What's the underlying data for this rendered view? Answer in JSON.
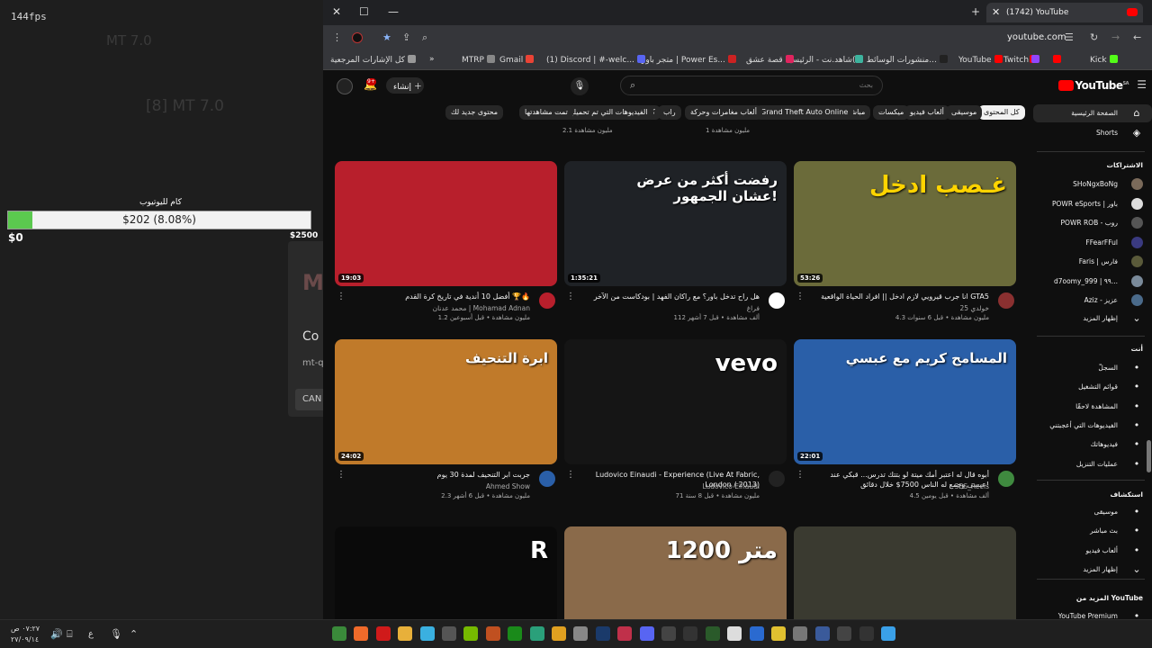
{
  "overlay": {
    "fps": "144fps",
    "ghost_a": "MT 7.0",
    "ghost_b": "[8] MT 7.0",
    "goal_title": "كام لليوتيوب",
    "goal_text": "$202 (8.08%)",
    "goal_progress_pct": 8.08,
    "goal_min": "$0",
    "goal_max": "$2500",
    "dialog": {
      "logo": "M",
      "title": "Co",
      "url": "mt-q",
      "button": "CAN"
    }
  },
  "browser": {
    "tab_title": "(1742) YouTube",
    "url": "youtube.com",
    "bookmarks": [
      {
        "label": "Kick",
        "color": "#53fc18"
      },
      {
        "label": "",
        "color": "#ff0000"
      },
      {
        "label": "",
        "color": "#ff0000"
      },
      {
        "label": "Twitch",
        "color": "#9146ff"
      },
      {
        "label": "YouTube",
        "color": "#ff0000"
      },
      {
        "label": "(1) منشورات الوسائط...",
        "color": "#222222"
      },
      {
        "label": "شاهد.نت - الرئيسية",
        "color": "#3db39e"
      },
      {
        "label": "قصة عشق",
        "color": "#e0245e"
      },
      {
        "label": "متجر باور | Power Es...",
        "color": "#cc2222"
      },
      {
        "label": "(1) Discord | #-welc...",
        "color": "#5865f2"
      },
      {
        "label": "Gmail",
        "color": "#ea4335"
      },
      {
        "label": "MTRP",
        "color": "#888888"
      },
      {
        "label": "»",
        "color": ""
      },
      {
        "label": "كل الإشارات المرجعية",
        "color": "#999999"
      }
    ]
  },
  "youtube": {
    "logo": "YouTube",
    "country": "SA",
    "search_placeholder": "بحث",
    "create_label": "إنشاء",
    "notif_count": "9+",
    "chips": [
      {
        "label": "كل المحتوى",
        "active": true
      },
      {
        "label": "موسيقى",
        "active": false
      },
      {
        "label": "ألعاب فيديو",
        "active": false
      },
      {
        "label": "ميكسات",
        "active": false
      },
      {
        "label": "مباشر",
        "active": false
      },
      {
        "label": "Grand Theft Auto Online",
        "active": false
      },
      {
        "label": "ألعاب مغامرات وحركة",
        "active": false
      },
      {
        "label": "راب",
        "active": false
      },
      {
        "label": "كرة القدم",
        "active": false
      },
      {
        "label": "الفيديوهات التي تم تحميلها مؤخرًا",
        "active": false
      },
      {
        "label": "تمت مشاهدتها",
        "active": false
      },
      {
        "label": "محتوى جديد لك",
        "active": false
      }
    ],
    "prev_meta": [
      "1 مليون مشاهدة",
      "2.1 مليون مشاهدة"
    ],
    "videos": [
      {
        "title": "انا جرب قيرويي لازم ادخل || افراد الحياة الواقعية GTA5",
        "channel": "خولدي 25",
        "meta": "4.3 مليون مشاهدة • قبل 6 سنوات",
        "duration": "53:26",
        "thumb_text": "غـصب ادخل",
        "bg": "#6b6b3a",
        "av": "#8a3030"
      },
      {
        "title": "هل راح تدخل باور؟ مع راكان الفهد | بودكاست من الآخر",
        "channel": "فراغ",
        "meta": "112 ألف مشاهدة • قبل 7 أشهر",
        "duration": "1:35:21",
        "thumb_text": "رفضت أكثر من عرض عشان الجمهور!",
        "bg": "#1f2226",
        "av": "#ffffff"
      },
      {
        "title": "أفضل 10 أندية في تاريخ كرة القدم 🏆🔥",
        "channel": "محمد عدنان | Mohamad Adnan",
        "meta": "1.2 مليون مشاهدة • قبل أسبوعين",
        "duration": "19:03",
        "thumb_text": "",
        "bg": "#b81f2c",
        "av": "#b81f2c"
      },
      {
        "title": "أبوه قال له اعتبر أمك ميتة لو بتتك تدرس... قبكي عند عيسى وجمع له الناس 7500$ خلال دقائق!",
        "channel": "3BS_Reels",
        "meta": "4.5 ألف مشاهدة • قبل يومين",
        "duration": "22:01",
        "thumb_text": "المسامح كريم مع عبسي",
        "bg": "#2a5fa8",
        "av": "#3f8a3f"
      },
      {
        "title": "Ludovico Einaudi - Experience (Live At Fabric, London / 2013)",
        "channel": "Ludovico Einaudi",
        "meta": "71 مليون مشاهدة • قبل 8 سنة",
        "duration": "",
        "thumb_text": "vevo",
        "bg": "#151515",
        "av": "#222222"
      },
      {
        "title": "جربت ابر التنحيف لمدة 30 يوم",
        "channel": "Ahmed Show",
        "meta": "2.3 مليون مشاهدة • قبل 6 أشهر",
        "duration": "24:02",
        "thumb_text": "ابرة التنحيف",
        "bg": "#c07a2a",
        "av": "#2a5fa8"
      },
      {
        "title": "",
        "channel": "",
        "meta": "",
        "duration": "",
        "thumb_text": "",
        "bg": "#3a3a30",
        "av": ""
      },
      {
        "title": "",
        "channel": "",
        "meta": "",
        "duration": "",
        "thumb_text": "1200 متر",
        "bg": "#8a6a4a",
        "av": ""
      },
      {
        "title": "",
        "channel": "",
        "meta": "",
        "duration": "",
        "thumb_text": "R",
        "bg": "#0a0a0a",
        "av": ""
      }
    ],
    "guide": {
      "home": "الصفحة الرئيسية",
      "shorts": "Shorts",
      "subs_header": "الاشتراكات",
      "subs": [
        {
          "name": "SHoNgxBoNg",
          "color": "#7a6a5a"
        },
        {
          "name": "POWR eSports | باور",
          "color": "#dddddd"
        },
        {
          "name": "POWR ROB - روب",
          "color": "#555555"
        },
        {
          "name": "FFearFFul",
          "color": "#3a3a80"
        },
        {
          "name": "Faris | فارس",
          "color": "#5a5a3a"
        },
        {
          "name": "d7oomy_999 | ٩٩...",
          "color": "#7a8a9a"
        },
        {
          "name": "Aziz - عزيز",
          "color": "#4a6a8a"
        }
      ],
      "show_more": "إظهار المزيد",
      "you_header": "أنت",
      "you_items": [
        "السجلّ",
        "قوائم التشغيل",
        "المشاهدة لاحقًا",
        "الفيديوهات التي أعجبتني",
        "فيديوهاتك",
        "عمليات التنزيل"
      ],
      "explore_header": "استكشاف",
      "explore_items": [
        "موسيقى",
        "بث مباشر",
        "ألعاب فيديو",
        "إظهار المزيد"
      ],
      "more_header": "المزيد من YouTube",
      "premium": "YouTube Premium"
    }
  },
  "taskbar": {
    "time": "٠٧:٢٧ ص",
    "date": "٢٧/٠٩/١٤",
    "lang": "ع"
  }
}
